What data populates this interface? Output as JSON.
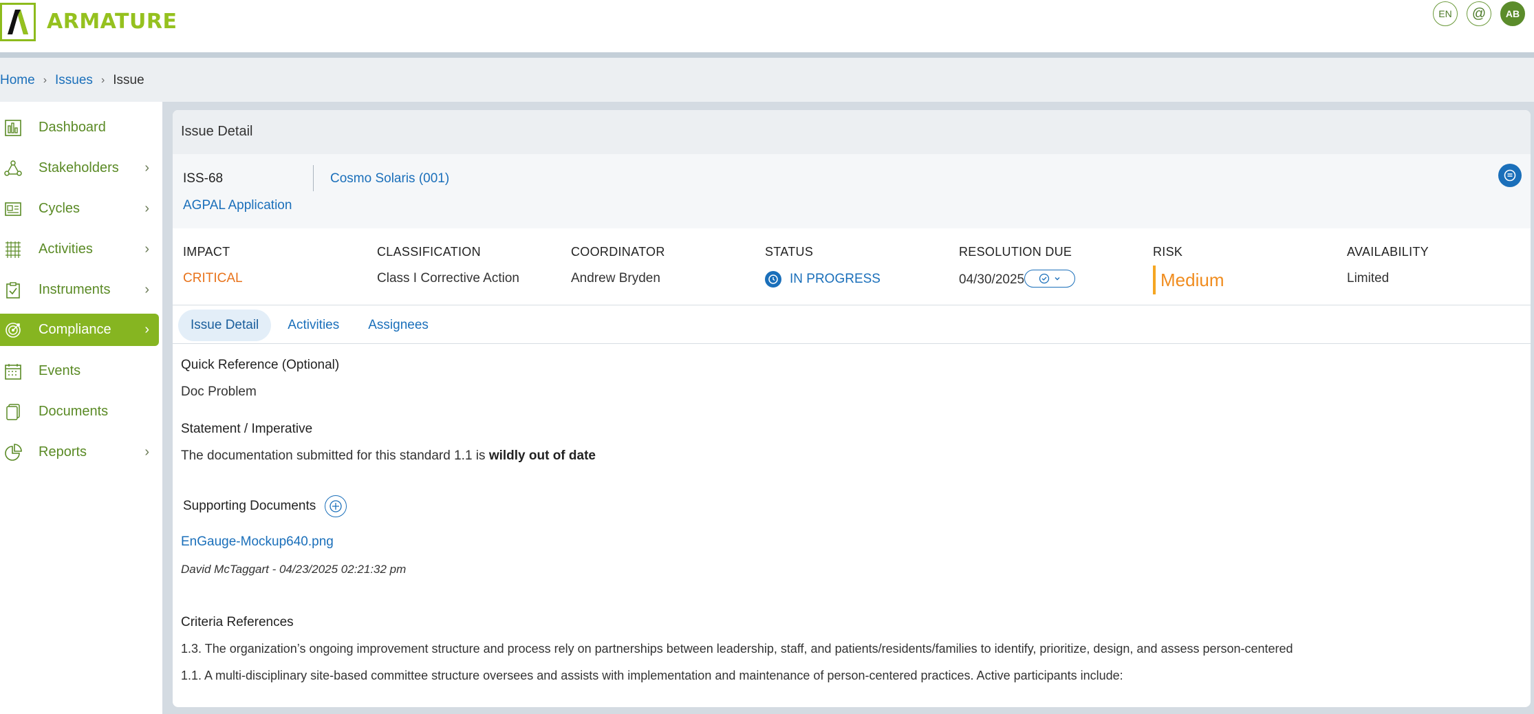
{
  "brand": {
    "name": "ARMATURE",
    "accent": "#86b521",
    "link": "#1a6fba"
  },
  "header": {
    "language": "EN",
    "mention_icon": "at-icon",
    "avatar_initials": "AB"
  },
  "breadcrumb": {
    "home": "Home",
    "issues": "Issues",
    "current": "Issue"
  },
  "sidebar": {
    "items": [
      {
        "label": "Dashboard",
        "icon": "dashboard-icon",
        "has_children": false,
        "active": false
      },
      {
        "label": "Stakeholders",
        "icon": "stakeholders-icon",
        "has_children": true,
        "active": false
      },
      {
        "label": "Cycles",
        "icon": "cycles-icon",
        "has_children": true,
        "active": false
      },
      {
        "label": "Activities",
        "icon": "activities-icon",
        "has_children": true,
        "active": false
      },
      {
        "label": "Instruments",
        "icon": "instruments-icon",
        "has_children": true,
        "active": false
      },
      {
        "label": "Compliance",
        "icon": "compliance-icon",
        "has_children": true,
        "active": true
      },
      {
        "label": "Events",
        "icon": "calendar-icon",
        "has_children": false,
        "active": false
      },
      {
        "label": "Documents",
        "icon": "documents-icon",
        "has_children": false,
        "active": false
      },
      {
        "label": "Reports",
        "icon": "reports-icon",
        "has_children": true,
        "active": false
      }
    ]
  },
  "issue": {
    "card_title": "Issue Detail",
    "id": "ISS-68",
    "project": "Cosmo Solaris (001)",
    "application": "AGPAL Application",
    "metrics": {
      "impact": {
        "label": "IMPACT",
        "value": "CRITICAL"
      },
      "classification": {
        "label": "CLASSIFICATION",
        "value": "Class I Corrective Action"
      },
      "coordinator": {
        "label": "COORDINATOR",
        "value": "Andrew Bryden"
      },
      "status": {
        "label": "STATUS",
        "value": "IN PROGRESS"
      },
      "resolution_due": {
        "label": "RESOLUTION DUE",
        "value": "04/30/2025"
      },
      "risk": {
        "label": "RISK",
        "value": "Medium"
      },
      "availability": {
        "label": "AVAILABILITY",
        "value": "Limited"
      }
    },
    "tabs": [
      "Issue Detail",
      "Activities",
      "Assignees"
    ],
    "active_tab": "Issue Detail",
    "quick_reference": {
      "label": "Quick Reference (Optional)",
      "value": "Doc Problem"
    },
    "statement": {
      "label": "Statement / Imperative",
      "text_prefix": "The documentation submitted for this standard 1.1 is ",
      "text_bold": "wildly out of date"
    },
    "supporting_documents": {
      "label": "Supporting Documents",
      "files": [
        {
          "name": "EnGauge-Mockup640.png",
          "meta": "David McTaggart - 04/23/2025 02:21:32 pm"
        }
      ]
    },
    "criteria": {
      "label": "Criteria References",
      "items": [
        "1.3. The organization’s ongoing improvement structure and process rely on partnerships between leadership, staff, and patients/residents/families to identify, prioritize, design, and assess person-centered",
        "1.1. A multi-disciplinary site-based committee structure oversees and assists with implementation and maintenance of person-centered practices. Active participants include:"
      ]
    }
  }
}
